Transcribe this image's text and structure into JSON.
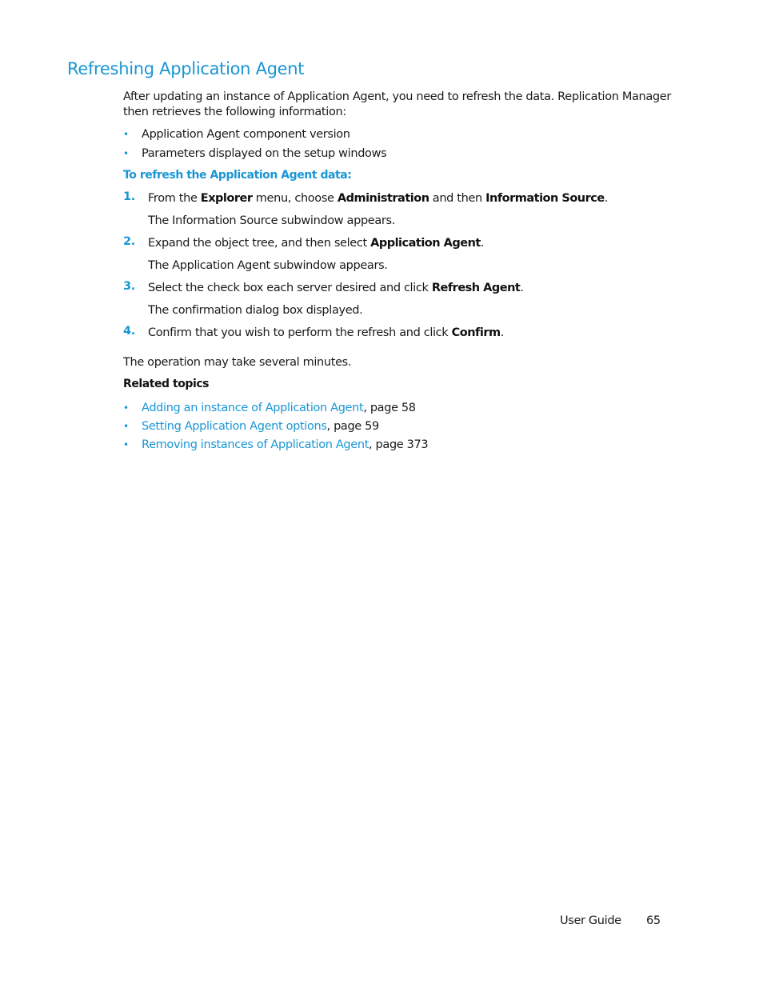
{
  "title": "Refreshing Application Agent",
  "intro": "After updating an instance of Application Agent, you need to refresh the data. Replication Manager then retrieves the following information:",
  "info_items": [
    "Application Agent component version",
    "Parameters displayed on the setup windows"
  ],
  "procedure_heading": "To refresh the Application Agent data:",
  "steps": [
    {
      "number": "1.",
      "parts": [
        "From the ",
        "Explorer",
        " menu, choose ",
        "Administration",
        " and then ",
        "Information Source",
        "."
      ],
      "result": "The Information Source subwindow appears."
    },
    {
      "number": "2.",
      "parts": [
        "Expand the object tree, and then select ",
        "Application Agent",
        "."
      ],
      "result": "The Application Agent subwindow appears."
    },
    {
      "number": "3.",
      "parts": [
        "Select the check box each server desired and click ",
        "Refresh Agent",
        "."
      ],
      "result": "The confirmation dialog box displayed."
    },
    {
      "number": "4.",
      "parts": [
        "Confirm that you wish to perform the refresh and click ",
        "Confirm",
        "."
      ],
      "result": ""
    }
  ],
  "operation_note": "The operation may take several minutes.",
  "related_heading": "Related topics",
  "related_topics": [
    {
      "link": "Adding an instance of Application Agent",
      "suffix": ", page 58"
    },
    {
      "link": "Setting Application Agent options",
      "suffix": ", page 59"
    },
    {
      "link": "Removing instances of Application Agent",
      "suffix": ", page 373"
    }
  ],
  "footer": {
    "label": "User Guide",
    "page": "65"
  },
  "colors": {
    "accent": "#1a96d4",
    "text": "#1a1a1a"
  },
  "bullet_glyph": "•"
}
